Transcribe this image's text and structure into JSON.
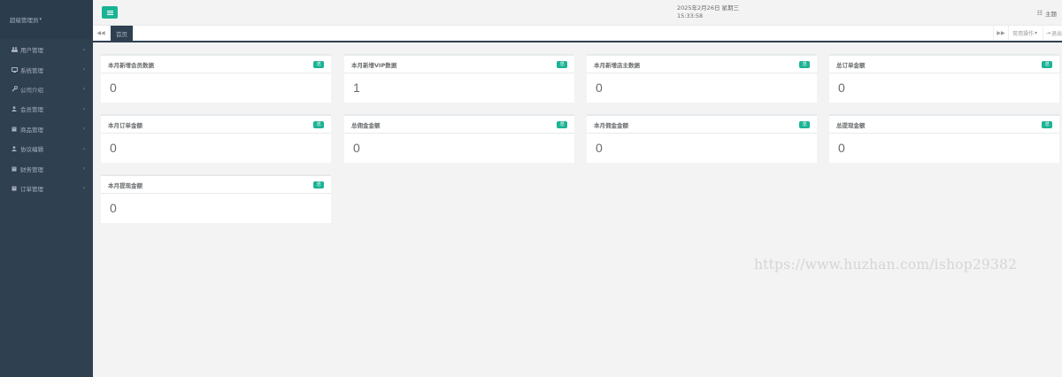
{
  "sidebar": {
    "user_label": "超级管理员",
    "items": [
      {
        "label": "用户管理",
        "icon": "users-icon"
      },
      {
        "label": "系统管理",
        "icon": "desktop-icon"
      },
      {
        "label": "公司介绍",
        "icon": "wrench-icon"
      },
      {
        "label": "会员管理",
        "icon": "user-icon"
      },
      {
        "label": "商品管理",
        "icon": "book-icon"
      },
      {
        "label": "协议编辑",
        "icon": "user-icon"
      },
      {
        "label": "财务管理",
        "icon": "book-icon"
      },
      {
        "label": "订单管理",
        "icon": "book-icon"
      }
    ]
  },
  "header": {
    "date": "2025年2月26日 星期三",
    "time": "15:33:58",
    "theme_label": "主题"
  },
  "tabs": {
    "active": "首页",
    "common_ops": "常用操作",
    "logout": "退出"
  },
  "cards": [
    {
      "title": "本月新增会员数据",
      "badge": "总",
      "value": "0"
    },
    {
      "title": "本月新增VIP数据",
      "badge": "总",
      "value": "1"
    },
    {
      "title": "本月新增店主数据",
      "badge": "总",
      "value": "0"
    },
    {
      "title": "总订单金额",
      "badge": "总",
      "value": "0"
    },
    {
      "title": "本月订单金额",
      "badge": "总",
      "value": "0"
    },
    {
      "title": "总佣金金额",
      "badge": "总",
      "value": "0"
    },
    {
      "title": "本月佣金金额",
      "badge": "总",
      "value": "0"
    },
    {
      "title": "总提现金额",
      "badge": "总",
      "value": "0"
    },
    {
      "title": "本月提现金额",
      "badge": "总",
      "value": "0"
    }
  ],
  "watermark": "https://www.huzhan.com/ishop29382",
  "colors": {
    "sidebar_bg": "#2f4050",
    "accent": "#1ab394",
    "content_bg": "#f3f3f4"
  }
}
